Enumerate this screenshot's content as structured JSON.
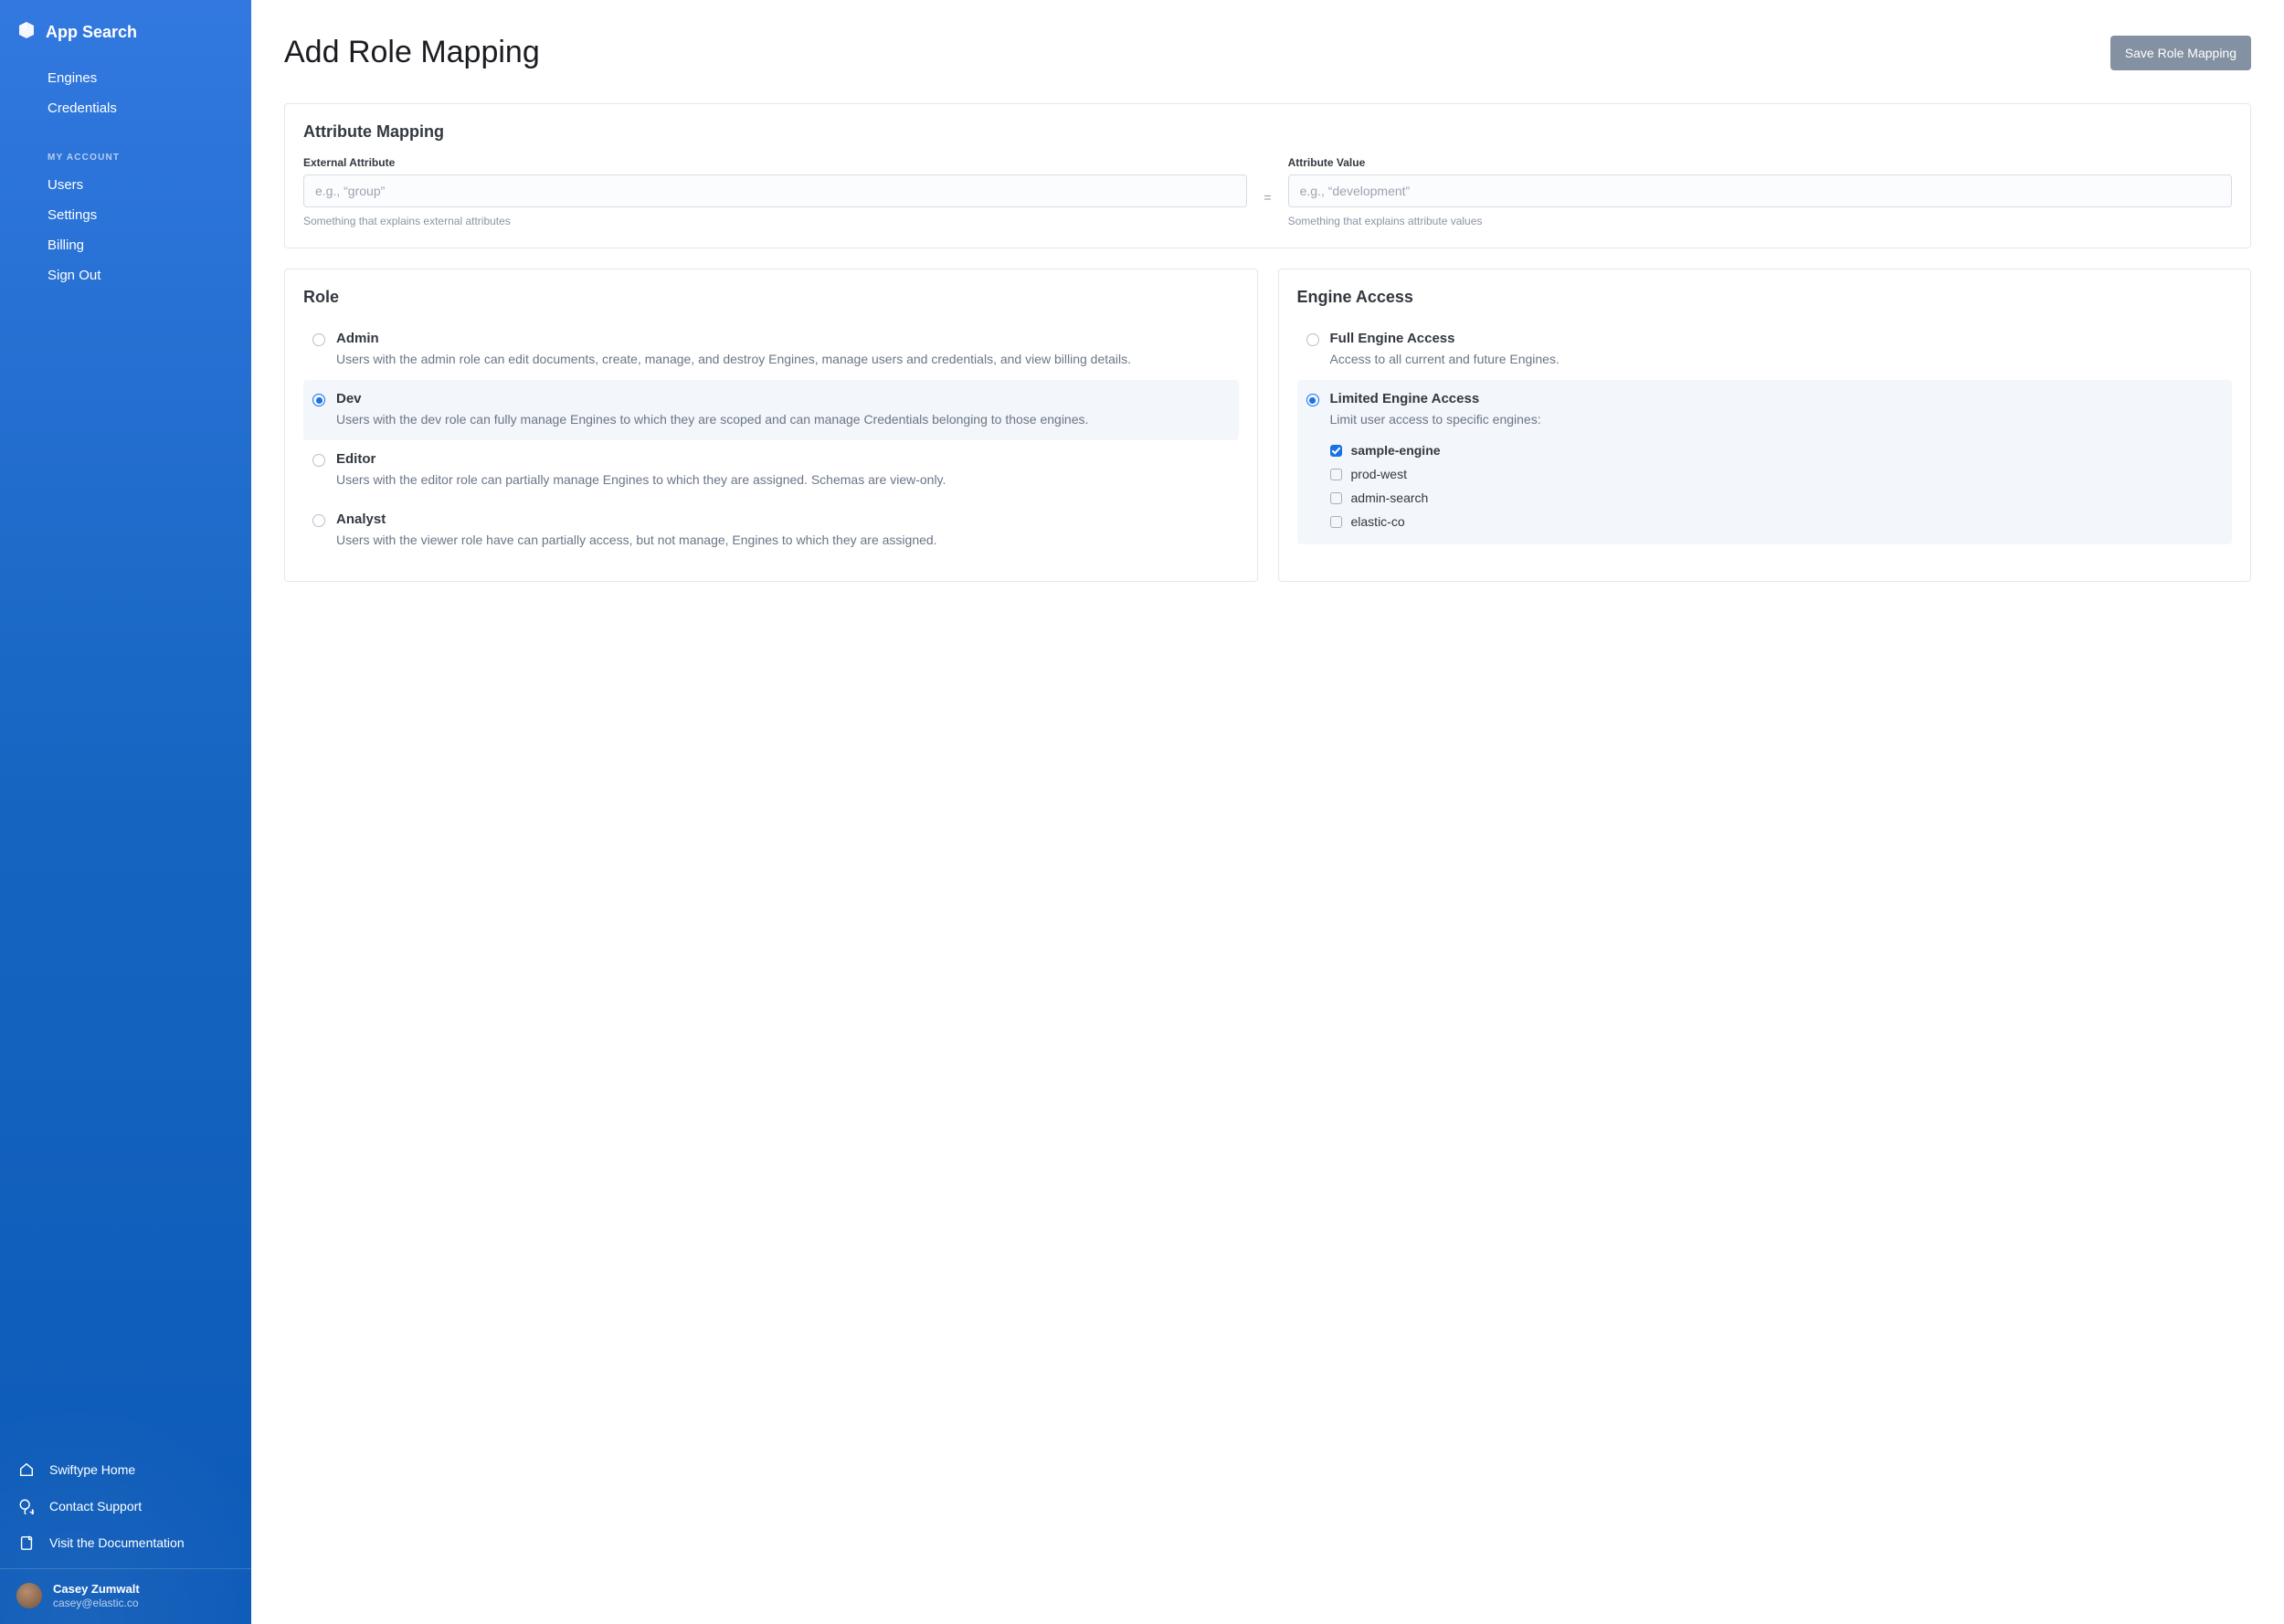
{
  "brand": {
    "name": "App Search"
  },
  "sidebar": {
    "nav1": [
      {
        "label": "Engines"
      },
      {
        "label": "Credentials"
      }
    ],
    "section_header": "MY ACCOUNT",
    "nav2": [
      {
        "label": "Users"
      },
      {
        "label": "Settings"
      },
      {
        "label": "Billing"
      },
      {
        "label": "Sign Out"
      }
    ],
    "bottom": [
      {
        "label": "Swiftype Home"
      },
      {
        "label": "Contact Support"
      },
      {
        "label": "Visit the Documentation"
      }
    ],
    "user": {
      "name": "Casey Zumwalt",
      "email": "casey@elastic.co"
    }
  },
  "page": {
    "title": "Add Role Mapping",
    "save_button": "Save Role Mapping"
  },
  "attribute_mapping": {
    "title": "Attribute Mapping",
    "external": {
      "label": "External Attribute",
      "placeholder": "e.g., “group”",
      "hint": "Something that explains external attributes"
    },
    "value": {
      "label": "Attribute Value",
      "placeholder": "e.g., “development”",
      "hint": "Something that explains attribute values"
    },
    "equals": "="
  },
  "role_panel": {
    "title": "Role",
    "options": [
      {
        "name": "Admin",
        "desc": "Users with the admin role can edit documents, create, manage, and destroy Engines, manage users and credentials, and view billing details.",
        "selected": false
      },
      {
        "name": "Dev",
        "desc": "Users with the dev role can fully manage Engines to which they are scoped and can manage Credentials belonging to those engines.",
        "selected": true
      },
      {
        "name": "Editor",
        "desc": "Users with the editor role can partially manage Engines to which they are assigned. Schemas are view-only.",
        "selected": false
      },
      {
        "name": "Analyst",
        "desc": "Users with the viewer role have can partially access, but not manage, Engines to which they are assigned.",
        "selected": false
      }
    ]
  },
  "engine_access_panel": {
    "title": "Engine Access",
    "options": [
      {
        "name": "Full Engine Access",
        "desc": "Access to all current and future Engines.",
        "selected": false
      },
      {
        "name": "Limited Engine Access",
        "desc": "Limit user access to specific engines:",
        "selected": true
      }
    ],
    "engines": [
      {
        "name": "sample-engine",
        "checked": true
      },
      {
        "name": "prod-west",
        "checked": false
      },
      {
        "name": "admin-search",
        "checked": false
      },
      {
        "name": "elastic-co",
        "checked": false
      }
    ]
  }
}
